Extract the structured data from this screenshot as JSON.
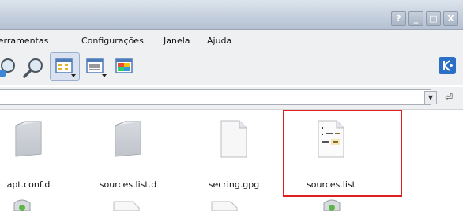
{
  "window": {
    "buttons": [
      "?",
      "_",
      "□",
      "X"
    ]
  },
  "menubar": {
    "items": [
      "Ferramentas",
      "Configurações",
      "Janela",
      "Ajuda"
    ]
  },
  "toolbar": {
    "icons": [
      "zoom-in-icon",
      "zoom-out-icon",
      "icon-view-icon",
      "detail-view-icon",
      "preview-icon"
    ]
  },
  "location": {
    "value": ""
  },
  "files": [
    {
      "name": "apt.conf.d",
      "icon": "folder-icon"
    },
    {
      "name": "sources.list.d",
      "icon": "folder-icon"
    },
    {
      "name": "secring.gpg",
      "icon": "document-icon"
    },
    {
      "name": "sources.list",
      "icon": "text-document-icon"
    }
  ],
  "colors": {
    "highlight": "#e02020",
    "titlebar": "#b4c1d2"
  }
}
